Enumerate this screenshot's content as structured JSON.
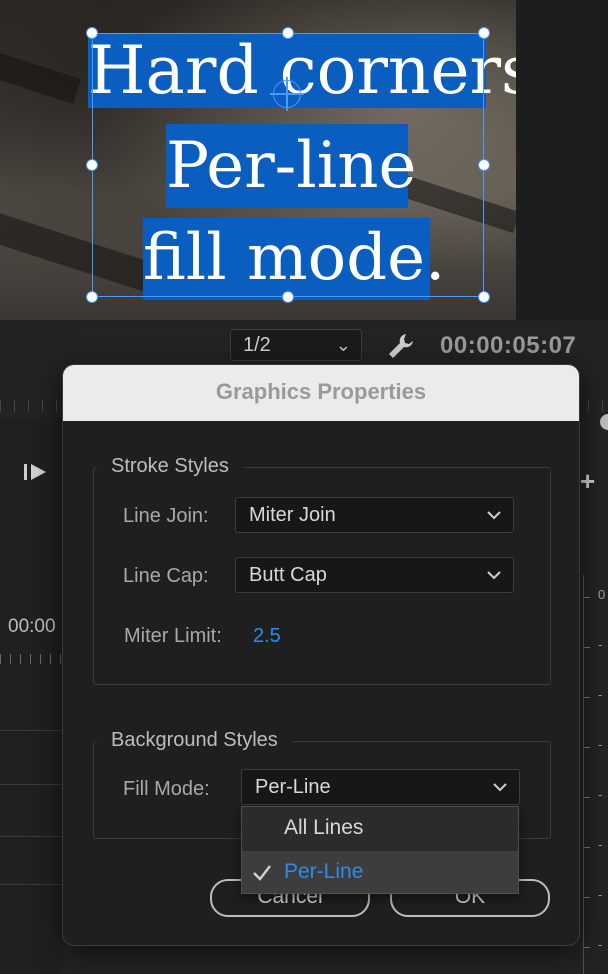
{
  "program_monitor": {
    "title_lines": [
      "Hard corners",
      "Per-line",
      "fill mode."
    ],
    "zoom": "1/2",
    "timecode": "00:00:05:07"
  },
  "timeline": {
    "timecode_partial": "00:00",
    "meter_labels": [
      "0",
      "-",
      "-",
      "-",
      "-",
      "-",
      "-",
      "-"
    ]
  },
  "dialog": {
    "title": "Graphics Properties",
    "stroke_styles": {
      "label": "Stroke Styles",
      "line_join_label": "Line Join:",
      "line_join_value": "Miter Join",
      "line_cap_label": "Line Cap:",
      "line_cap_value": "Butt Cap",
      "miter_limit_label": "Miter Limit:",
      "miter_limit_value": "2.5"
    },
    "background_styles": {
      "label": "Background Styles",
      "fill_mode_label": "Fill Mode:",
      "fill_mode_value": "Per-Line",
      "options": [
        "All Lines",
        "Per-Line"
      ],
      "selected_option": "Per-Line"
    },
    "cancel_label": "Cancel",
    "ok_label": "OK"
  },
  "colors": {
    "selection_blue": "#0a5ec0",
    "accent_blue": "#2d8ceb",
    "handle_blue": "#4a9bff"
  },
  "icons": {
    "wrench": "wrench-icon",
    "play": "step-play-icon",
    "plus": "plus-icon",
    "chevron": "chevron-down-icon",
    "check": "checkmark-icon"
  }
}
